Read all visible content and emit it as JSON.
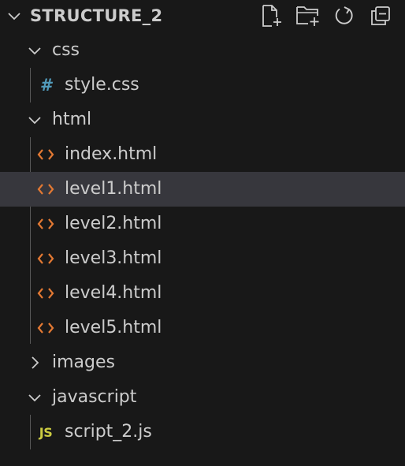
{
  "explorer": {
    "title": "STRUCTURE_2",
    "actions": [
      {
        "name": "new-file-icon"
      },
      {
        "name": "new-folder-icon"
      },
      {
        "name": "refresh-icon"
      },
      {
        "name": "collapse-all-icon"
      }
    ],
    "tree": {
      "css_folder": "css",
      "style_css": "style.css",
      "html_folder": "html",
      "index_html": "index.html",
      "level1_html": "level1.html",
      "level2_html": "level2.html",
      "level3_html": "level3.html",
      "level4_html": "level4.html",
      "level5_html": "level5.html",
      "images_folder": "images",
      "javascript_folder": "javascript",
      "script_js": "script_2.js"
    },
    "icon_glyphs": {
      "css": "#",
      "js": "JS"
    },
    "colors": {
      "background": "#181818",
      "selected_row": "#37373d",
      "text": "#cccccc",
      "html_icon": "#e37933",
      "css_icon": "#519aba",
      "js_icon": "#cbcb41"
    },
    "selected_item": "level1.html"
  }
}
